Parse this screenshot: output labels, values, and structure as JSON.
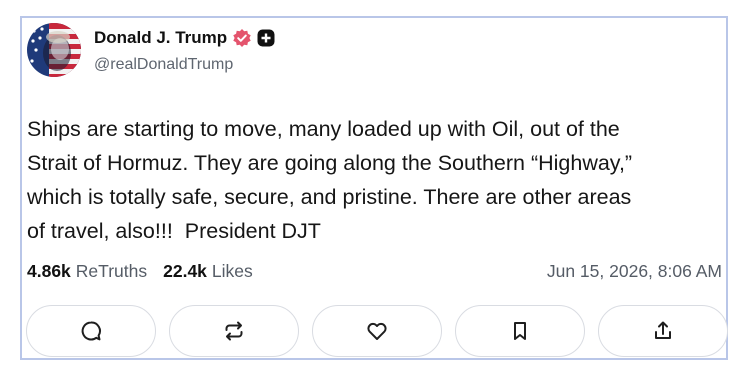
{
  "author": {
    "display_name": "Donald J. Trump",
    "handle": "@realDonaldTrump",
    "verified_icon": "verified-badge-icon",
    "extra_badge_icon": "plus-badge-icon"
  },
  "post": {
    "text": "Ships are starting to move, many loaded up with Oil, out of the\nStrait of Hormuz. They are going along the Southern “Highway,”\nwhich is totally safe, secure, and pristine. There are other areas\nof travel, also!!!  President DJT"
  },
  "stats": {
    "retruths_count": "4.86k",
    "retruths_label": "ReTruths",
    "likes_count": "22.4k",
    "likes_label": "Likes",
    "timestamp": "Jun 15, 2026, 8:06 AM"
  },
  "actions": [
    {
      "name": "reply",
      "icon": "reply-icon"
    },
    {
      "name": "retruth",
      "icon": "retruth-icon"
    },
    {
      "name": "like",
      "icon": "heart-icon"
    },
    {
      "name": "bookmark",
      "icon": "bookmark-icon"
    },
    {
      "name": "share",
      "icon": "share-icon"
    }
  ],
  "colors": {
    "border": "#b9c6e8",
    "verified": "#e4546d",
    "text_primary": "#111111",
    "text_secondary": "#5f6670",
    "button_border": "#d9dce2"
  }
}
